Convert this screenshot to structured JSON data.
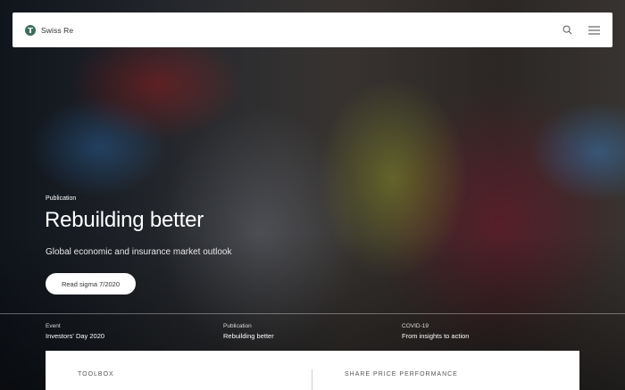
{
  "header": {
    "brand": "Swiss Re",
    "icons": {
      "logo": "swiss-re-logo-icon",
      "search": "search-icon",
      "menu": "hamburger-menu-icon"
    }
  },
  "hero": {
    "eyebrow": "Publication",
    "title": "Rebuilding better",
    "subtitle": "Global economic and insurance market outlook",
    "cta_label": "Read sigma 7/2020"
  },
  "teasers": [
    {
      "category": "Event",
      "title": "Investors' Day 2020"
    },
    {
      "category": "Publication",
      "title": "Rebuilding better"
    },
    {
      "category": "COVID-19",
      "title": "From insights to action"
    }
  ],
  "panel": {
    "left_heading": "TOOLBOX",
    "right_heading": "SHARE PRICE PERFORMANCE"
  },
  "colors": {
    "brand": "#3c6e5a",
    "header_bg": "#ffffff",
    "cta_bg": "#ffffff"
  }
}
